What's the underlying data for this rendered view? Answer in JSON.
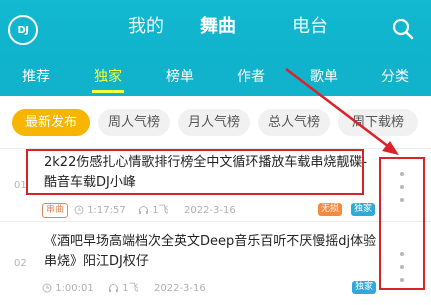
{
  "header": {
    "logo_text": "DJ",
    "tabs": [
      {
        "label": "我的"
      },
      {
        "label": "舞曲"
      },
      {
        "label": "电台"
      }
    ],
    "active_tab": "舞曲"
  },
  "subnav": {
    "items": [
      {
        "label": "推荐"
      },
      {
        "label": "独家"
      },
      {
        "label": "榜单"
      },
      {
        "label": "作者"
      },
      {
        "label": "歌单"
      },
      {
        "label": "分类"
      }
    ],
    "active": "独家"
  },
  "chips": [
    {
      "label": "最新发布"
    },
    {
      "label": "周人气榜"
    },
    {
      "label": "月人气榜"
    },
    {
      "label": "总人气榜"
    },
    {
      "label": "周下载榜"
    }
  ],
  "songs": [
    {
      "index": "01",
      "title": "2k22伤感扎心情歌排行榜全中文循环播放车载串烧靓碟-酷音车载DJ小峰",
      "type_tag": "串曲",
      "duration": "1:17:57",
      "plays": "1飞",
      "date": "2022-3-16",
      "badges": [
        "无损",
        "独家"
      ]
    },
    {
      "index": "02",
      "title": "《酒吧早场高端档次全英文Deep音乐百听不厌慢摇dj体验串烧》阳江DJ权仔",
      "type_tag": "",
      "duration": "1:00:01",
      "plays": "1飞",
      "date": "2022-3-16",
      "badges": [
        "独家"
      ]
    }
  ],
  "colors": {
    "header_bg": "#12b9d1",
    "active_subnav": "#f4ff3a",
    "chip_active": "#f7b500",
    "annotation": "#d9232b"
  }
}
